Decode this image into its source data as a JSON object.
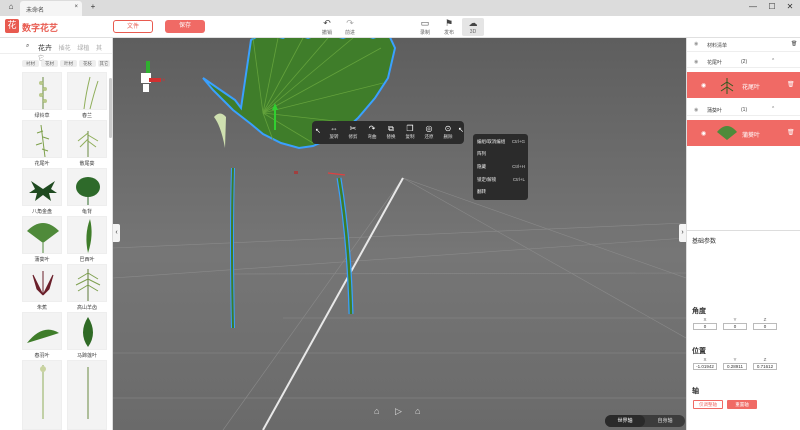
{
  "window": {
    "tab_title": "未命名",
    "add_tab": "+",
    "minimize": "—",
    "maximize": "☐",
    "close": "✕"
  },
  "header": {
    "logo_glyph": "花",
    "app_name": "数字花艺",
    "file_button": "文件",
    "save_button": "保存",
    "tools": [
      {
        "icon": "undo-icon",
        "label": "撤销"
      },
      {
        "icon": "redo-icon",
        "label": "前进"
      },
      {
        "icon": "record-icon",
        "label": "录制"
      },
      {
        "icon": "publish-icon",
        "label": "发布"
      },
      {
        "icon": "cloud-icon",
        "label": "3D"
      }
    ]
  },
  "left_panel": {
    "tabs": [
      "花卉",
      "插花",
      "绿植",
      "其它"
    ],
    "active_tab": "花卉",
    "filters": [
      "衬材",
      "花材",
      "叶材",
      "花枝",
      "其它"
    ],
    "items": [
      {
        "label": "绿铃草"
      },
      {
        "label": "春兰"
      },
      {
        "label": "花尾叶"
      },
      {
        "label": "散尾葵"
      },
      {
        "label": "八角金盘"
      },
      {
        "label": "龟背"
      },
      {
        "label": "蒲葵叶"
      },
      {
        "label": "巴西叶"
      },
      {
        "label": "朱蕉"
      },
      {
        "label": "高山羊齿"
      },
      {
        "label": "春羽叶"
      },
      {
        "label": "马蹄莲叶"
      }
    ]
  },
  "popup_toolbar": {
    "items": [
      {
        "icon": "move-icon",
        "label": "旋转"
      },
      {
        "icon": "scissors-icon",
        "label": "修剪"
      },
      {
        "icon": "bend-icon",
        "label": "弯曲"
      },
      {
        "icon": "replace-icon",
        "label": "替换"
      },
      {
        "icon": "copy-icon",
        "label": "复制"
      },
      {
        "icon": "target-icon",
        "label": "还原"
      },
      {
        "icon": "delete-icon",
        "label": "删除"
      }
    ]
  },
  "context_menu": {
    "items": [
      {
        "label": "编组/取消编组",
        "shortcut": "Ctrl+G"
      },
      {
        "label": "阵列",
        "shortcut": ""
      },
      {
        "label": "隐藏",
        "shortcut": "Ctrl+H"
      },
      {
        "label": "锁定/解锁",
        "shortcut": "Ctrl+L"
      },
      {
        "label": "翻转",
        "shortcut": ""
      }
    ]
  },
  "right_panel": {
    "material_title": "材料清单",
    "groups": [
      {
        "name": "花尾叶",
        "count": "(2)",
        "item_label": "花尾叶"
      },
      {
        "name": "蒲葵叶",
        "count": "(1)",
        "item_label": "蒲葵叶"
      }
    ],
    "basic_params": "基础参数",
    "angle_title": "角度",
    "angle": {
      "x_label": "X",
      "y_label": "Y",
      "z_label": "Z",
      "x": "0",
      "y": "0",
      "z": "0"
    },
    "position_title": "位置",
    "position": {
      "x_label": "X",
      "y_label": "Y",
      "z_label": "Z",
      "x": "-1.01942",
      "y": "0.28911",
      "z": "0.71612"
    },
    "axis_title": "轴",
    "axis_btn1": "仅调整轴",
    "axis_btn2": "重置轴"
  },
  "bottom": {
    "world_axis": "世界轴",
    "self_axis": "自身轴"
  },
  "colors": {
    "accent": "#f06a65",
    "dark_popup": "#2b2b2b",
    "leaf_green": "#3f7d2a",
    "outline_blue": "#3aa0ff"
  }
}
